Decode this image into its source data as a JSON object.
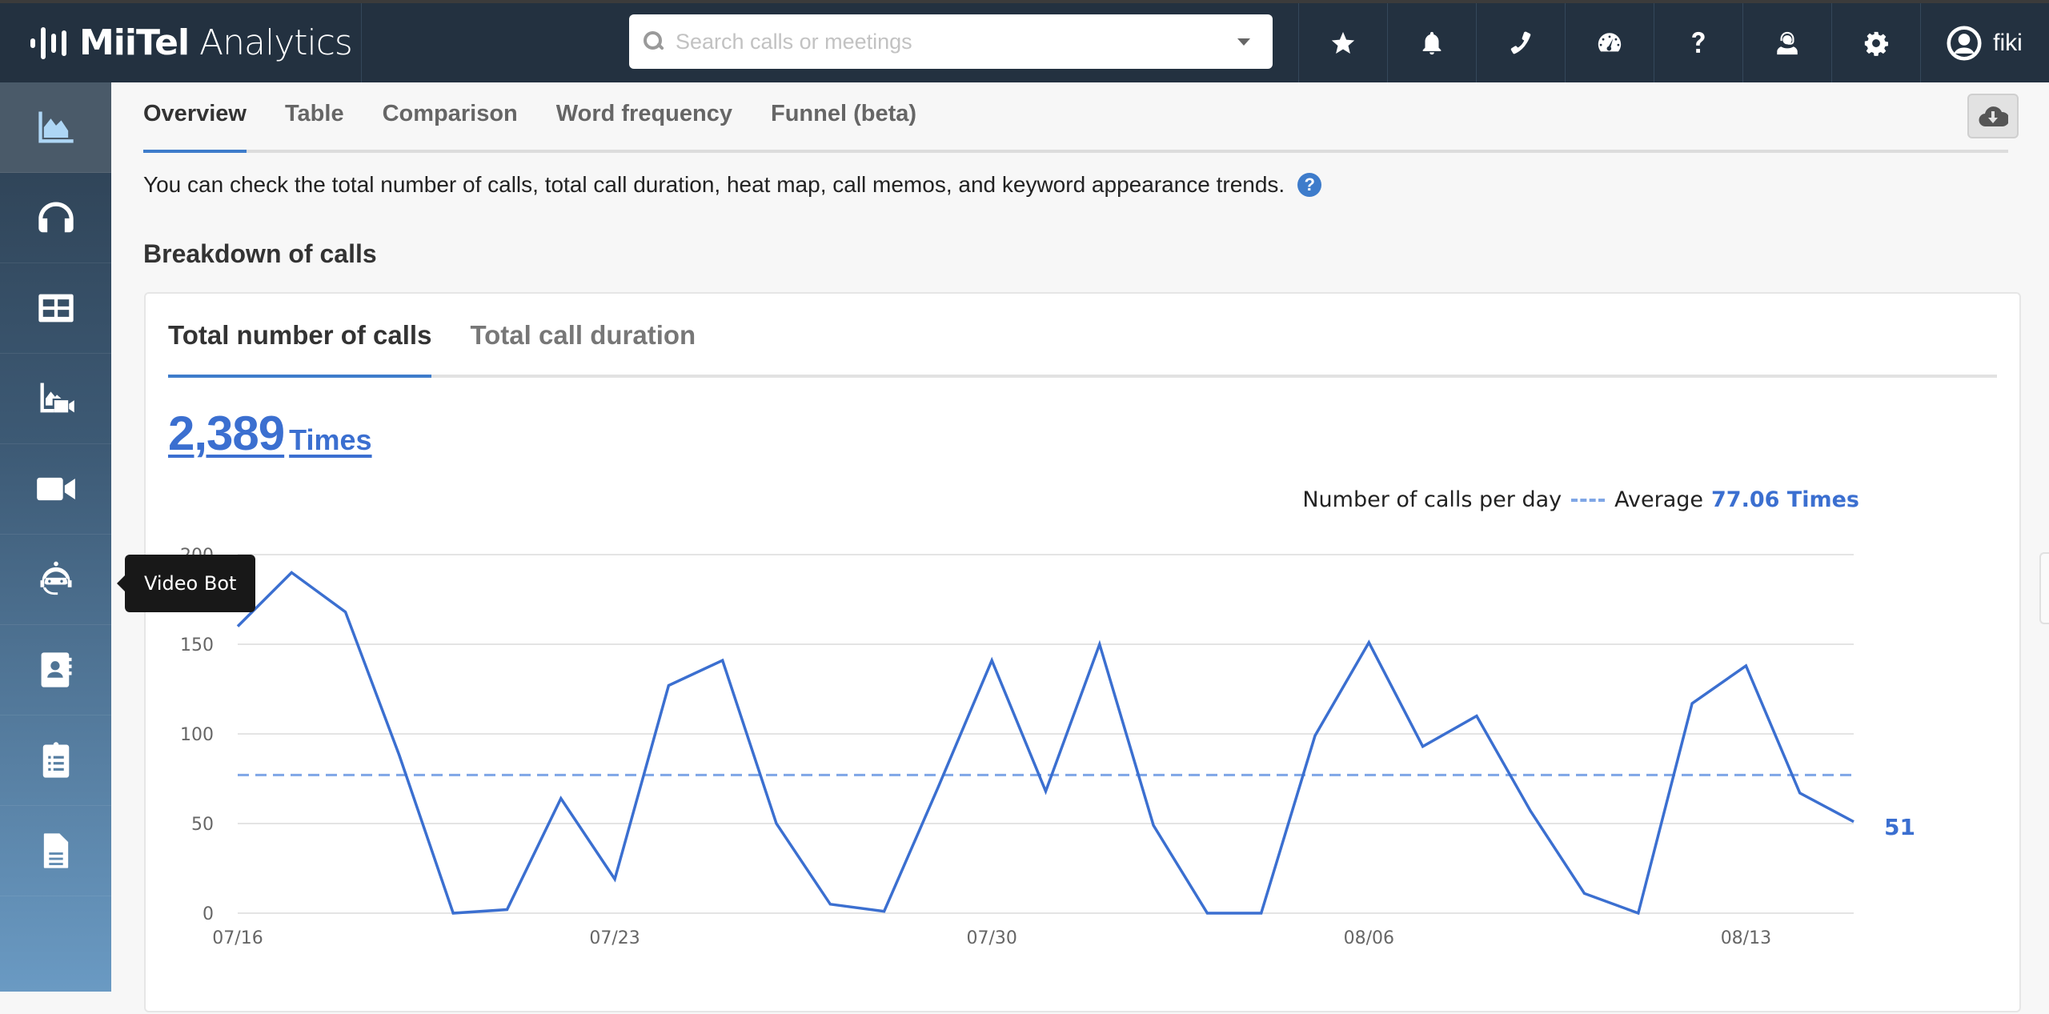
{
  "app": {
    "brand_main": "MiiTel",
    "brand_sub": "Analytics"
  },
  "search": {
    "placeholder": "Search calls or meetings",
    "value": ""
  },
  "topbar": {
    "icons": [
      "star-icon",
      "bell-icon",
      "phone-icon",
      "dashboard-gauge-icon",
      "question-icon",
      "support-agent-icon",
      "gear-icon"
    ],
    "user_name": "fiki"
  },
  "sidebar": {
    "items": [
      {
        "name": "analytics",
        "icon": "area-chart-icon",
        "active": true
      },
      {
        "name": "calls",
        "icon": "headphones-icon",
        "active": false
      },
      {
        "name": "table",
        "icon": "table-icon",
        "active": false
      },
      {
        "name": "meeting-analytics",
        "icon": "chart-video-icon",
        "active": false
      },
      {
        "name": "video",
        "icon": "video-camera-icon",
        "active": false
      },
      {
        "name": "video-bot",
        "icon": "robot-icon",
        "active": false
      },
      {
        "name": "contacts",
        "icon": "address-book-icon",
        "active": false
      },
      {
        "name": "clipboard",
        "icon": "clipboard-list-icon",
        "active": false
      },
      {
        "name": "documents",
        "icon": "document-icon",
        "active": false
      }
    ],
    "tooltip": "Video Bot"
  },
  "main": {
    "tabs": [
      {
        "label": "Overview",
        "active": true
      },
      {
        "label": "Table",
        "active": false
      },
      {
        "label": "Comparison",
        "active": false
      },
      {
        "label": "Word frequency",
        "active": false
      },
      {
        "label": "Funnel (beta)",
        "active": false
      }
    ],
    "description": "You can check the total number of calls, total call duration, heat map, call memos, and keyword appearance trends.",
    "section_title": "Breakdown of calls",
    "card": {
      "tabs": [
        {
          "label": "Total number of calls",
          "active": true
        },
        {
          "label": "Total call duration",
          "active": false
        }
      ],
      "total_value": "2,389",
      "total_unit": "Times",
      "legend_series": "Number of calls per day",
      "legend_average_label": "Average",
      "legend_average_value": "77.06 Times"
    }
  },
  "colors": {
    "accent": "#3e7ccb",
    "line": "#3b6fd0",
    "average_line": "#7fa6e6",
    "topbar": "#233140"
  },
  "chart_data": {
    "type": "line",
    "title": "",
    "xlabel": "",
    "ylabel": "",
    "x": [
      "07/16",
      "07/17",
      "07/18",
      "07/19",
      "07/20",
      "07/21",
      "07/22",
      "07/23",
      "07/24",
      "07/25",
      "07/26",
      "07/27",
      "07/28",
      "07/29",
      "07/30",
      "07/31",
      "08/01",
      "08/02",
      "08/03",
      "08/04",
      "08/05",
      "08/06",
      "08/07",
      "08/08",
      "08/09",
      "08/10",
      "08/11",
      "08/12",
      "08/13",
      "08/14",
      "08/15"
    ],
    "x_tick_labels": [
      "07/16",
      "07/23",
      "07/30",
      "08/06",
      "08/13"
    ],
    "series": [
      {
        "name": "Number of calls per day",
        "values": [
          160,
          190,
          168,
          88,
          0,
          2,
          64,
          19,
          127,
          141,
          50,
          5,
          1,
          70,
          141,
          68,
          150,
          49,
          0,
          0,
          99,
          151,
          93,
          110,
          57,
          11,
          0,
          117,
          138,
          67,
          51
        ]
      }
    ],
    "average": 77.06,
    "last_value_label": "51",
    "y_ticks": [
      0,
      50,
      100,
      150,
      200
    ],
    "ylim": [
      0,
      200
    ],
    "grid": true,
    "legend_position": "top-right"
  }
}
